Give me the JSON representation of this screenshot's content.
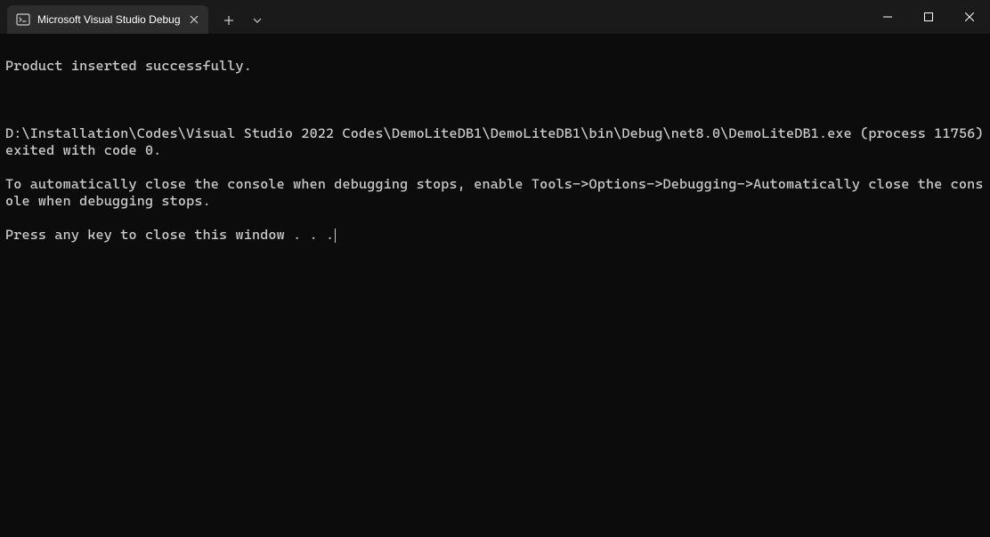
{
  "tab": {
    "title": "Microsoft Visual Studio Debug"
  },
  "console": {
    "line1": "Product inserted successfully.",
    "line2": "D:\\Installation\\Codes\\Visual Studio 2022 Codes\\DemoLiteDB1\\DemoLiteDB1\\bin\\Debug\\net8.0\\DemoLiteDB1.exe (process 11756) exited with code 0.",
    "line3": "To automatically close the console when debugging stops, enable Tools->Options->Debugging->Automatically close the console when debugging stops.",
    "line4": "Press any key to close this window . . ."
  }
}
